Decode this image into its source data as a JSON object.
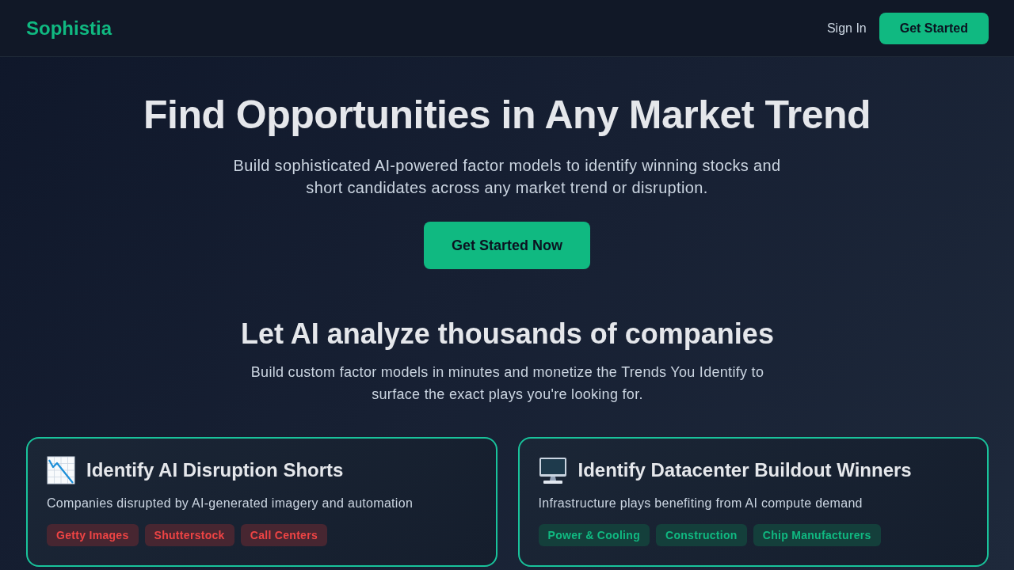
{
  "nav": {
    "logo": "Sophistia",
    "sign_in": "Sign In",
    "cta": "Get Started"
  },
  "hero": {
    "title": "Find Opportunities in Any Market Trend",
    "subtitle": "Build sophisticated AI-powered factor models to identify winning stocks and short candidates across any market trend or disruption.",
    "cta": "Get Started Now"
  },
  "features": {
    "title": "Let AI analyze thousands of companies",
    "subtitle": "Build custom factor models in minutes and monetize the Trends You Identify to surface the exact plays you're looking for.",
    "cards": [
      {
        "kind": "short",
        "title": "Identify AI Disruption Shorts",
        "description": "Companies disrupted by AI-generated imagery and automation",
        "tags": [
          "Getty Images",
          "Shutterstock",
          "Call Centers"
        ]
      },
      {
        "kind": "long",
        "title": "Identify Datacenter Buildout Winners",
        "description": "Infrastructure plays benefiting from AI compute demand",
        "tags": [
          "Power & Cooling",
          "Construction",
          "Chip Manufacturers"
        ]
      }
    ]
  }
}
